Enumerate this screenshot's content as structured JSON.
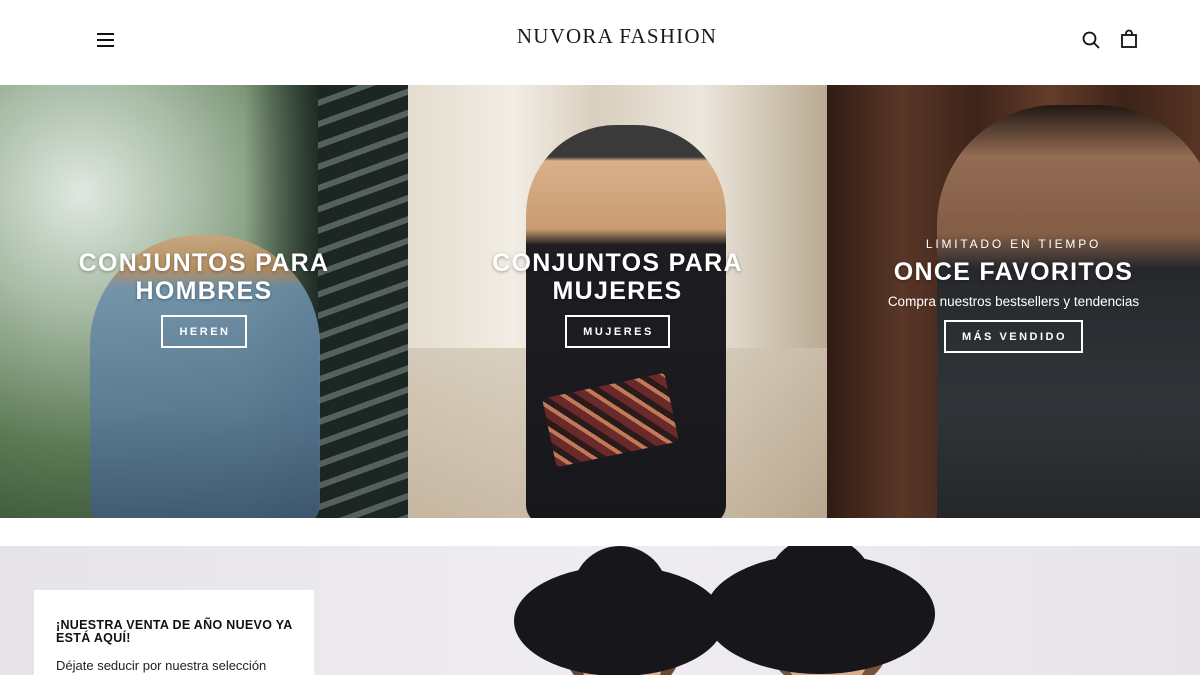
{
  "header": {
    "logo": "NUVORA FASHION",
    "icons": [
      "menu-icon",
      "search-icon",
      "bag-icon"
    ]
  },
  "hero": [
    {
      "title": "CONJUNTOS PARA HOMBRES",
      "button": "HEREN"
    },
    {
      "title": "CONJUNTOS PARA MUJERES",
      "button": "MUJERES"
    },
    {
      "kicker": "LIMITADO EN TIEMPO",
      "title": "ONCE FAVORITOS",
      "subtitle": "Compra nuestros bestsellers y tendencias",
      "button": "MÁS VENDIDO"
    }
  ],
  "promo": {
    "title": "¡NUESTRA VENTA DE AÑO NUEVO YA ESTÁ AQUÍ!",
    "text": "Déjate seducir por nuestra selección"
  },
  "colors": {
    "text": "#111111",
    "background": "#ffffff",
    "overlay_text": "#ffffff"
  }
}
